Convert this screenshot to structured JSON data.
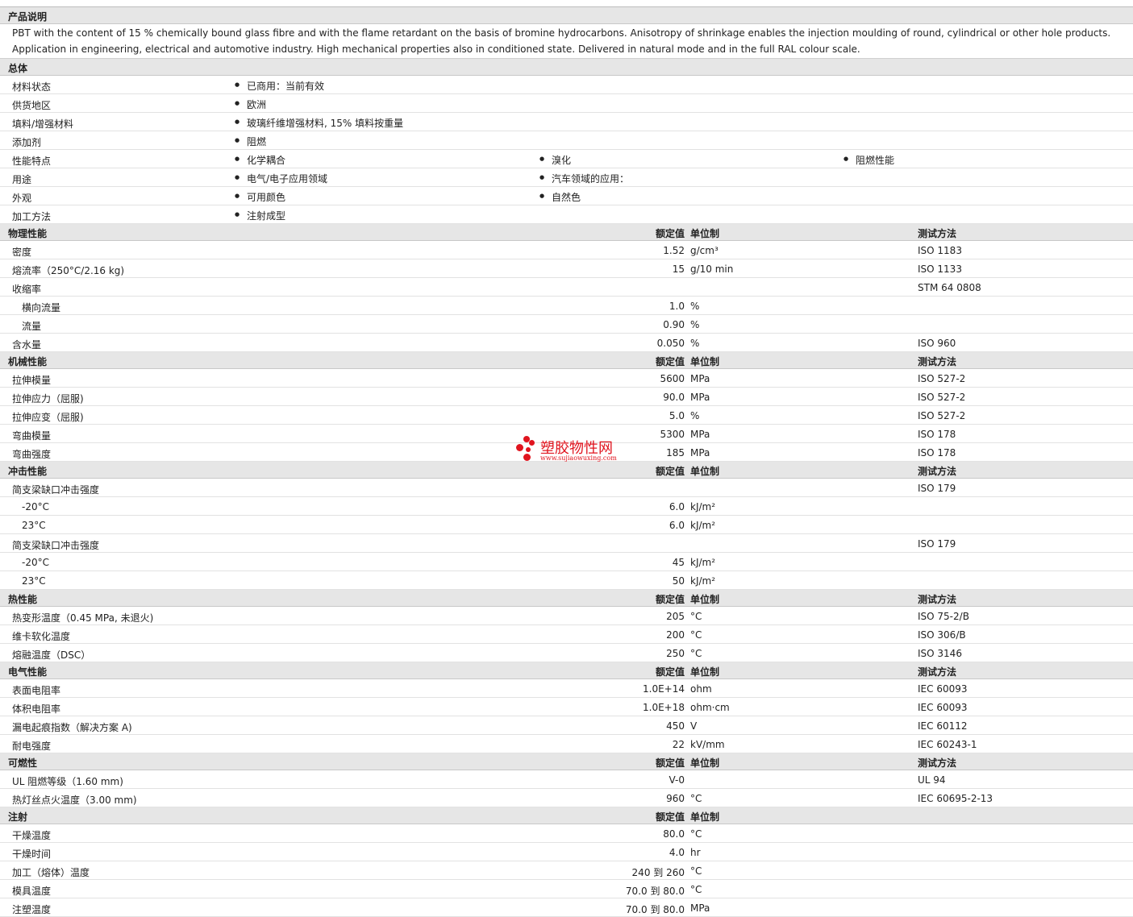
{
  "description": {
    "heading": "产品说明",
    "text": "PBT with the content of 15 % chemically bound glass fibre and with the flame retardant on the basis of bromine hydrocarbons. Anisotropy of shrinkage enables the injection moulding of round, cylindrical or other hole products. Application in engineering, electrical and automotive industry. High mechanical properties also in conditioned state. Delivered in natural mode and in the full RAL colour scale."
  },
  "general": {
    "heading": "总体",
    "rows": [
      {
        "label": "材料状态",
        "items": [
          "已商用：当前有效"
        ]
      },
      {
        "label": "供货地区",
        "items": [
          "欧洲"
        ]
      },
      {
        "label": "填料/增强材料",
        "items": [
          "玻璃纤维增强材料, 15% 填料按重量"
        ]
      },
      {
        "label": "添加剂",
        "items": [
          "阻燃"
        ]
      },
      {
        "label": "性能特点",
        "items": [
          "化学耦合",
          "溴化",
          "阻燃性能"
        ]
      },
      {
        "label": "用途",
        "items": [
          "电气/电子应用领域",
          "汽车领域的应用："
        ]
      },
      {
        "label": "外观",
        "items": [
          "可用颜色",
          "自然色"
        ]
      },
      {
        "label": "加工方法",
        "items": [
          "注射成型"
        ]
      }
    ]
  },
  "headers": {
    "value": "额定值",
    "unit": "单位制",
    "method": "测试方法"
  },
  "sections": [
    {
      "heading": "物理性能",
      "method_header": true,
      "rows": [
        {
          "label": "密度",
          "value": "1.52",
          "unit": "g/cm³",
          "method": "ISO 1183",
          "indent": false
        },
        {
          "label": "熔流率（250°C/2.16 kg)",
          "value": "15",
          "unit": "g/10 min",
          "method": "ISO 1133",
          "indent": false
        },
        {
          "label": "收缩率",
          "value": "",
          "unit": "",
          "method": "STM 64 0808",
          "indent": false
        },
        {
          "label": "横向流量",
          "value": "1.0",
          "unit": "%",
          "method": "",
          "indent": true
        },
        {
          "label": "流量",
          "value": "0.90",
          "unit": "%",
          "method": "",
          "indent": true
        },
        {
          "label": "含水量",
          "value": "0.050",
          "unit": "%",
          "method": "ISO 960",
          "indent": false
        }
      ]
    },
    {
      "heading": "机械性能",
      "method_header": true,
      "rows": [
        {
          "label": "拉伸模量",
          "value": "5600",
          "unit": "MPa",
          "method": "ISO 527-2",
          "indent": false
        },
        {
          "label": "拉伸应力（屈服)",
          "value": "90.0",
          "unit": "MPa",
          "method": "ISO 527-2",
          "indent": false
        },
        {
          "label": "拉伸应变（屈服)",
          "value": "5.0",
          "unit": "%",
          "method": "ISO 527-2",
          "indent": false
        },
        {
          "label": "弯曲模量",
          "value": "5300",
          "unit": "MPa",
          "method": "ISO 178",
          "indent": false
        },
        {
          "label": "弯曲强度",
          "value": "185",
          "unit": "MPa",
          "method": "ISO 178",
          "indent": false
        }
      ]
    },
    {
      "heading": "冲击性能",
      "method_header": true,
      "rows": [
        {
          "label": "简支梁缺口冲击强度",
          "value": "",
          "unit": "",
          "method": "ISO 179",
          "indent": false
        },
        {
          "label": "-20°C",
          "value": "6.0",
          "unit": "kJ/m²",
          "method": "",
          "indent": true
        },
        {
          "label": "23°C",
          "value": "6.0",
          "unit": "kJ/m²",
          "method": "",
          "indent": true
        },
        {
          "label": "简支梁缺口冲击强度",
          "value": "",
          "unit": "",
          "method": "ISO 179",
          "indent": false
        },
        {
          "label": "-20°C",
          "value": "45",
          "unit": "kJ/m²",
          "method": "",
          "indent": true
        },
        {
          "label": "23°C",
          "value": "50",
          "unit": "kJ/m²",
          "method": "",
          "indent": true
        }
      ]
    },
    {
      "heading": "热性能",
      "method_header": true,
      "rows": [
        {
          "label": "热变形温度（0.45 MPa, 未退火)",
          "value": "205",
          "unit": "°C",
          "method": "ISO 75-2/B",
          "indent": false
        },
        {
          "label": "维卡软化温度",
          "value": "200",
          "unit": "°C",
          "method": "ISO 306/B",
          "indent": false
        },
        {
          "label": "熔融温度（DSC）",
          "value": "250",
          "unit": "°C",
          "method": "ISO 3146",
          "indent": false
        }
      ]
    },
    {
      "heading": "电气性能",
      "method_header": true,
      "rows": [
        {
          "label": "表面电阻率",
          "value": "1.0E+14",
          "unit": "ohm",
          "method": "IEC 60093",
          "indent": false
        },
        {
          "label": "体积电阻率",
          "value": "1.0E+18",
          "unit": "ohm·cm",
          "method": "IEC 60093",
          "indent": false
        },
        {
          "label": "漏电起痕指数（解决方案 A)",
          "value": "450",
          "unit": "V",
          "method": "IEC 60112",
          "indent": false
        },
        {
          "label": "耐电强度",
          "value": "22",
          "unit": "kV/mm",
          "method": "IEC 60243-1",
          "indent": false
        }
      ]
    },
    {
      "heading": "可燃性",
      "method_header": true,
      "rows": [
        {
          "label": "UL 阻燃等级（1.60 mm)",
          "value": "V-0",
          "unit": "",
          "method": "UL 94",
          "indent": false
        },
        {
          "label": "热灯丝点火温度（3.00 mm)",
          "value": "960",
          "unit": "°C",
          "method": "IEC 60695-2-13",
          "indent": false
        }
      ]
    },
    {
      "heading": "注射",
      "method_header": false,
      "rows": [
        {
          "label": "干燥温度",
          "value": "80.0",
          "unit": "°C",
          "method": "",
          "indent": false
        },
        {
          "label": "干燥时间",
          "value": "4.0",
          "unit": "hr",
          "method": "",
          "indent": false
        },
        {
          "label": "加工（熔体）温度",
          "value": "240 到  260",
          "unit": "°C",
          "method": "",
          "indent": false
        },
        {
          "label": "模具温度",
          "value": "70.0 到  80.0",
          "unit": "°C",
          "method": "",
          "indent": false
        },
        {
          "label": "注塑温度",
          "value": "70.0 到  80.0",
          "unit": "MPa",
          "method": "",
          "indent": false
        }
      ]
    }
  ],
  "watermark": {
    "brand": "塑胶物性网",
    "url": "www.sujiaowuxing.com",
    "color": "#e0141e"
  }
}
